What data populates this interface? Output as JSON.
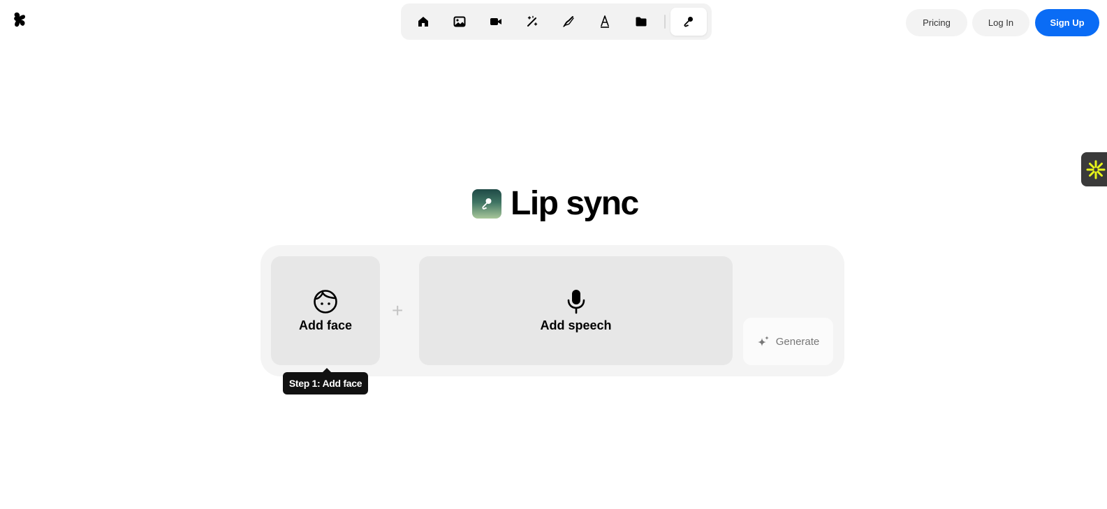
{
  "header": {
    "logo_icon": "brand-logo-icon",
    "toolbar": [
      {
        "icon": "home-icon",
        "active": false
      },
      {
        "icon": "image-icon",
        "active": false
      },
      {
        "icon": "video-camera-icon",
        "active": false
      },
      {
        "icon": "magic-wand-icon",
        "active": false
      },
      {
        "icon": "pen-brush-icon",
        "active": false
      },
      {
        "icon": "pen-nib-icon",
        "active": false
      },
      {
        "icon": "folder-icon",
        "active": false
      },
      {
        "icon": "microphone-icon",
        "active": true
      }
    ],
    "pricing_label": "Pricing",
    "login_label": "Log In",
    "signup_label": "Sign Up",
    "accent_color": "#0a6cf5"
  },
  "side_widget": {
    "icon": "sparkle-asterisk-icon",
    "color": "#e8f51a"
  },
  "main": {
    "title": "Lip sync",
    "title_icon": "microphone-app-icon",
    "face_card": {
      "label": "Add face",
      "icon": "face-icon"
    },
    "plus_sign": "+",
    "speech_card": {
      "label": "Add speech",
      "icon": "microphone-icon"
    },
    "generate_label": "Generate",
    "generate_icon": "sparkles-icon",
    "tooltip": "Step 1: Add face"
  }
}
